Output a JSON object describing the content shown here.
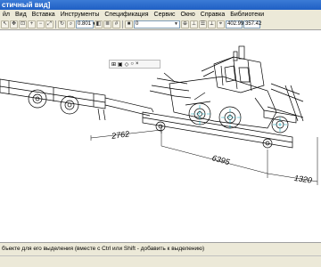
{
  "window": {
    "title": "стичный вид]"
  },
  "menu": [
    "йл",
    "Вид",
    "Вставка",
    "Инструменты",
    "Спецификация",
    "Сервис",
    "Окно",
    "Справка",
    "Библиотеки"
  ],
  "toolbar": {
    "scale_value": "0.801",
    "layer_value": "0",
    "coord_x": "402.99",
    "coord_y": "357.42"
  },
  "drawing": {
    "dimensions": [
      "2762",
      "6395",
      "1320"
    ]
  },
  "statusbar": {
    "hint": "бъекте для его выделения (вместе с Ctrl или Shift - добавить к выделению)"
  }
}
